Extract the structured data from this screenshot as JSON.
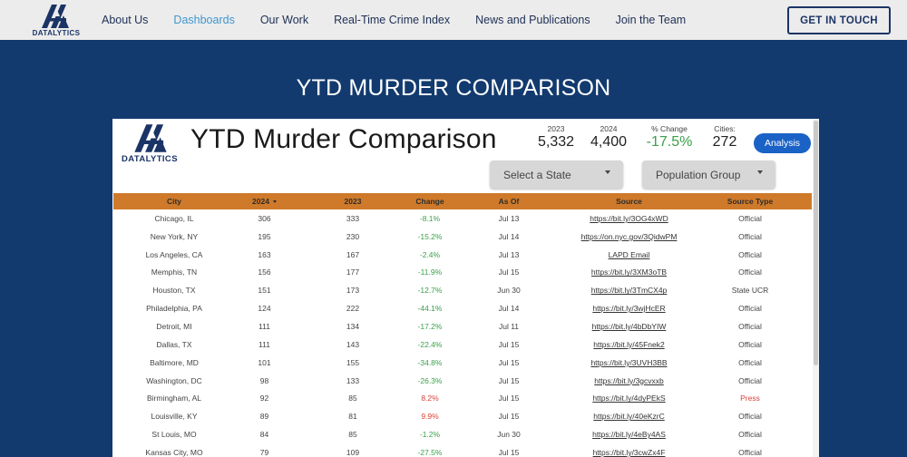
{
  "nav": {
    "logo_text": "DATALYTICS",
    "links": [
      {
        "label": "About Us",
        "active": false
      },
      {
        "label": "Dashboards",
        "active": true
      },
      {
        "label": "Our Work",
        "active": false
      },
      {
        "label": "Real-Time Crime Index",
        "active": false
      },
      {
        "label": "News and Publications",
        "active": false
      },
      {
        "label": "Join the Team",
        "active": false
      }
    ],
    "cta": "GET IN TOUCH"
  },
  "page_title": "YTD MURDER COMPARISON",
  "dashboard": {
    "logo_text": "DATALYTICS",
    "title": "YTD Murder Comparison",
    "stats": {
      "y2023": {
        "label": "2023",
        "value": "5,332"
      },
      "y2024": {
        "label": "2024",
        "value": "4,400"
      },
      "change": {
        "label": "% Change",
        "value": "-17.5%"
      },
      "cities": {
        "label": "Cities:",
        "value": "272"
      }
    },
    "analysis_button": "Analysis",
    "filters": {
      "state": "Select a State",
      "population": "Population Group"
    },
    "table": {
      "headers": [
        "City",
        "2024",
        "2023",
        "Change",
        "As Of",
        "Source",
        "Source Type"
      ],
      "rows": [
        [
          "Chicago, IL",
          "306",
          "333",
          "-8.1%",
          "Jul 13",
          "https://bit.ly/3OG4xWD",
          "Official"
        ],
        [
          "New York, NY",
          "195",
          "230",
          "-15.2%",
          "Jul 14",
          "https://on.nyc.gov/3QidwPM",
          "Official"
        ],
        [
          "Los Angeles, CA",
          "163",
          "167",
          "-2.4%",
          "Jul 13",
          "LAPD Email",
          "Official"
        ],
        [
          "Memphis, TN",
          "156",
          "177",
          "-11.9%",
          "Jul 15",
          "https://bit.ly/3XM3oTB",
          "Official"
        ],
        [
          "Houston, TX",
          "151",
          "173",
          "-12.7%",
          "Jun 30",
          "https://bit.ly/3TmCX4p",
          "State UCR"
        ],
        [
          "Philadelphia, PA",
          "124",
          "222",
          "-44.1%",
          "Jul 14",
          "https://bit.ly/3wjHcER",
          "Official"
        ],
        [
          "Detroit, MI",
          "111",
          "134",
          "-17.2%",
          "Jul 11",
          "https://bit.ly/4bDbYIW",
          "Official"
        ],
        [
          "Dallas, TX",
          "111",
          "143",
          "-22.4%",
          "Jul 15",
          "https://bit.ly/45Fnek2",
          "Official"
        ],
        [
          "Baltimore, MD",
          "101",
          "155",
          "-34.8%",
          "Jul 15",
          "https://bit.ly/3UVH3BB",
          "Official"
        ],
        [
          "Washington, DC",
          "98",
          "133",
          "-26.3%",
          "Jul 15",
          "https://bit.ly/3gcvxxb",
          "Official"
        ],
        [
          "Birmingham, AL",
          "92",
          "85",
          "8.2%",
          "Jul 15",
          "https://bit.ly/4dyPEkS",
          "Press"
        ],
        [
          "Louisville, KY",
          "89",
          "81",
          "9.9%",
          "Jul 15",
          "https://bit.ly/40eKzrC",
          "Official"
        ],
        [
          "St Louis, MO",
          "84",
          "85",
          "-1.2%",
          "Jun 30",
          "https://bit.ly/4eBy4AS",
          "Official"
        ],
        [
          "Kansas City, MO",
          "79",
          "109",
          "-27.5%",
          "Jul 15",
          "https://bit.ly/3cwZx4F",
          "Official"
        ]
      ]
    }
  },
  "colors": {
    "page_bg": "#123a6e",
    "nav_bg": "#ececec",
    "header_orange": "#cf7a2a",
    "accent_blue": "#1a62c6",
    "negative_change": "#3aa04a",
    "positive_change": "#d9423a"
  }
}
